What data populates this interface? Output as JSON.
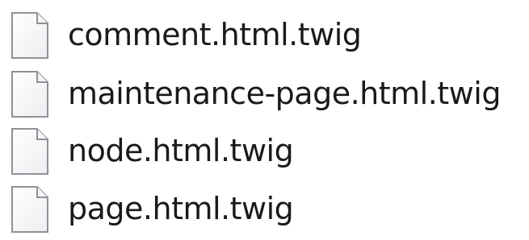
{
  "files": [
    {
      "name": "comment.html.twig",
      "icon": "blank-file-icon"
    },
    {
      "name": "maintenance-page.html.twig",
      "icon": "blank-file-icon"
    },
    {
      "name": "node.html.twig",
      "icon": "blank-file-icon"
    },
    {
      "name": "page.html.twig",
      "icon": "blank-file-icon"
    }
  ]
}
